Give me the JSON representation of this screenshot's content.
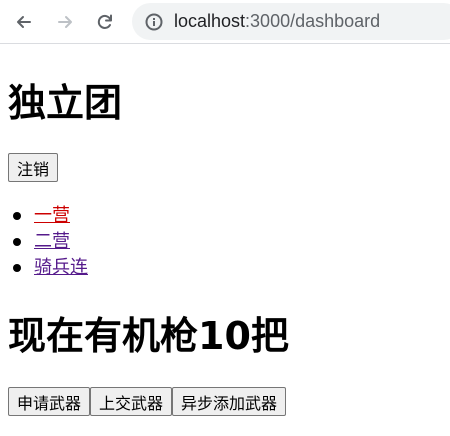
{
  "browser": {
    "url_host": "localhost",
    "url_rest": ":3000/dashboard"
  },
  "page": {
    "title": "独立团",
    "logout_label": "注销",
    "nav_links": [
      {
        "label": "一营",
        "state": "active",
        "color": "#cc0000"
      },
      {
        "label": "二营",
        "state": "visited",
        "color": "#551a8b"
      },
      {
        "label": "骑兵连",
        "state": "visited",
        "color": "#551a8b"
      }
    ],
    "status_heading": "现在有机枪10把",
    "actions": {
      "apply_label": "申请武器",
      "submit_label": "上交武器",
      "async_add_label": "异步添加武器"
    }
  }
}
